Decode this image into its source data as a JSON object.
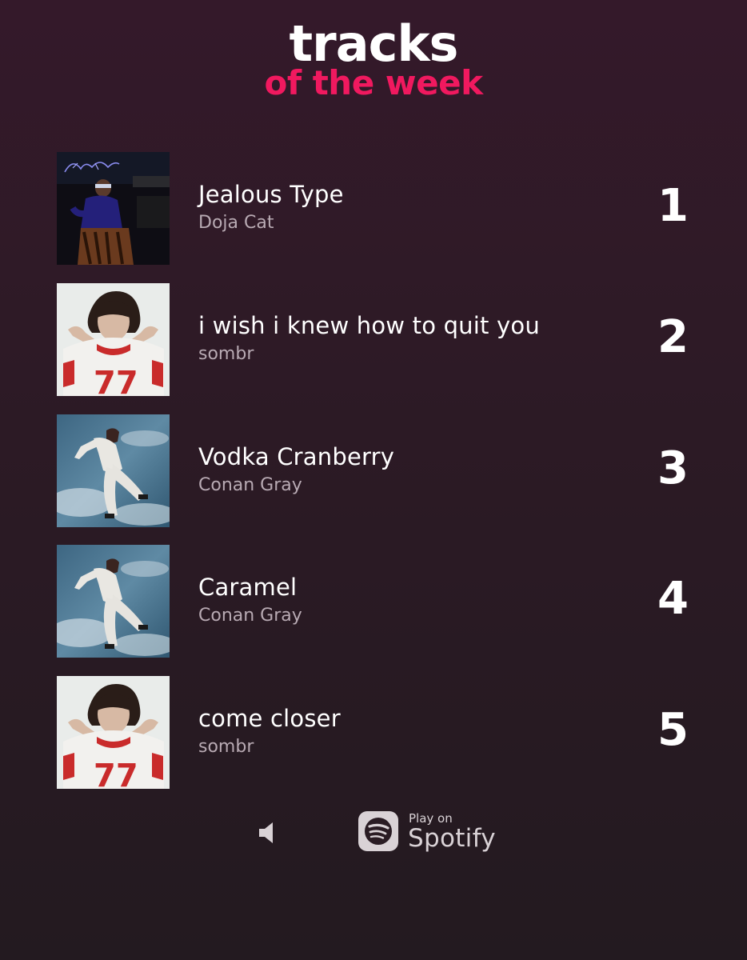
{
  "header": {
    "title": "tracks",
    "subtitle": "of the week"
  },
  "colors": {
    "accent": "#f0195f",
    "background_top": "#34192a",
    "background_bottom": "#231a20",
    "artist_text": "#b8aab3"
  },
  "tracks": [
    {
      "rank": "1",
      "title": "Jealous Type",
      "artist": "Doja Cat",
      "cover": "album-art-doja-cat-icon"
    },
    {
      "rank": "2",
      "title": "i wish i knew how to quit you",
      "artist": "sombr",
      "cover": "album-art-sombr-icon"
    },
    {
      "rank": "3",
      "title": "Vodka Cranberry",
      "artist": "Conan Gray",
      "cover": "album-art-conan-gray-icon"
    },
    {
      "rank": "4",
      "title": "Caramel",
      "artist": "Conan Gray",
      "cover": "album-art-conan-gray-icon"
    },
    {
      "rank": "5",
      "title": "come closer",
      "artist": "sombr",
      "cover": "album-art-sombr-icon"
    }
  ],
  "footer": {
    "speaker_icon": "speaker-icon",
    "play_on": "Play on",
    "service": "Spotify",
    "service_icon": "spotify-logo-icon"
  }
}
